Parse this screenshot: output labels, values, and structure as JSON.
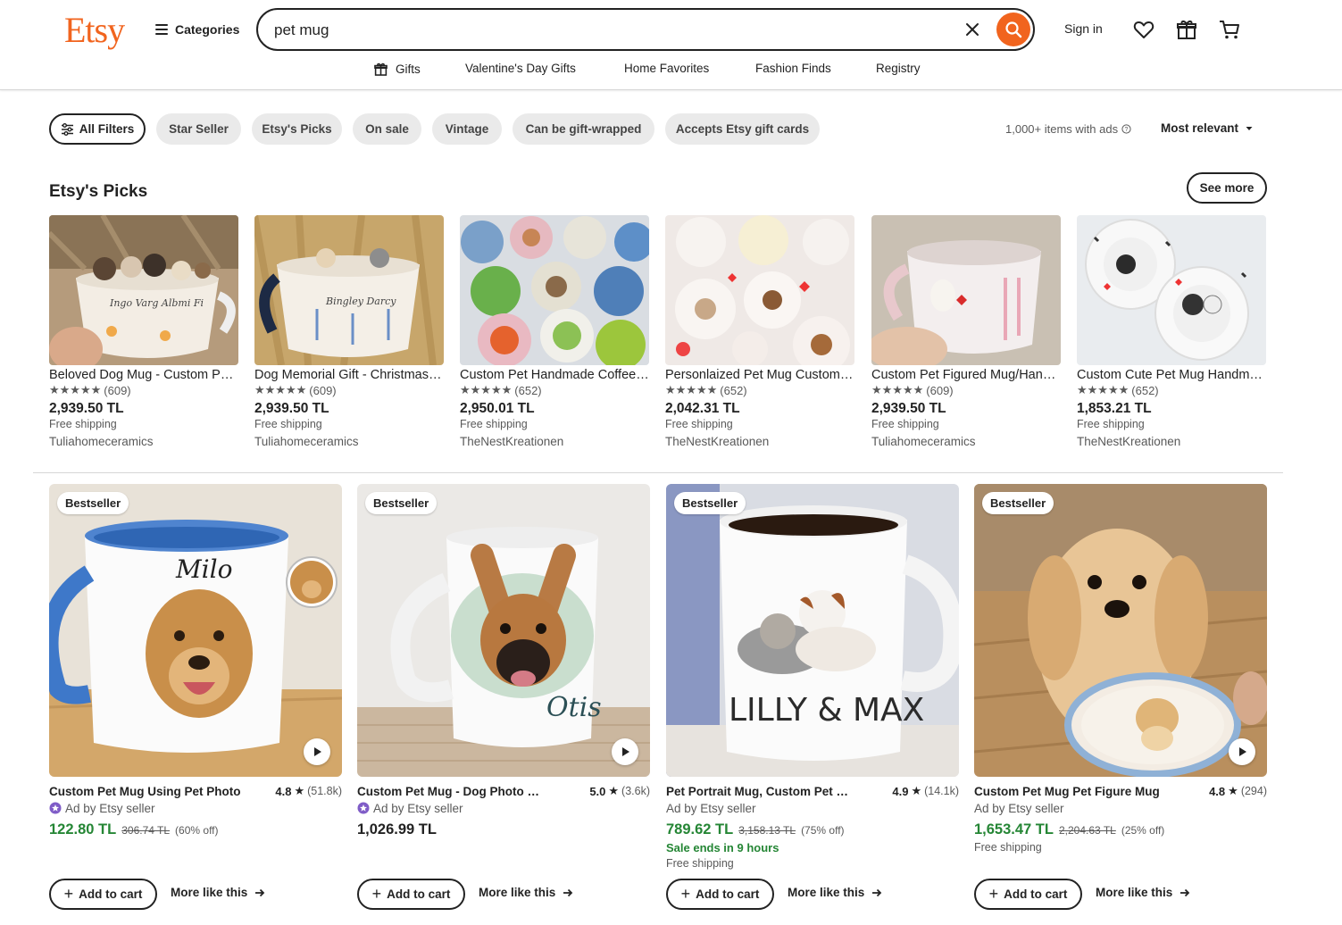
{
  "header": {
    "logo": "Etsy",
    "categories_label": "Categories",
    "search_value": "pet mug",
    "signin_label": "Sign in"
  },
  "subnav": [
    "Gifts",
    "Valentine's Day Gifts",
    "Home Favorites",
    "Fashion Finds",
    "Registry"
  ],
  "filters": {
    "all": "All Filters",
    "chips": [
      "Star Seller",
      "Etsy's Picks",
      "On sale",
      "Vintage",
      "Can be gift-wrapped",
      "Accepts Etsy gift cards"
    ],
    "items_count": "1,000+ items with ads",
    "sort_label": "Most relevant"
  },
  "picks": {
    "title": "Etsy's Picks",
    "see_more": "See more",
    "items": [
      {
        "title": "Beloved Dog Mug - Custom Pet Mug",
        "reviews": "(609)",
        "price": "2,939.50 TL",
        "shipping": "Free shipping",
        "shop": "Tuliahomeceramics"
      },
      {
        "title": "Dog Memorial Gift - Christmas Gift",
        "reviews": "(609)",
        "price": "2,939.50 TL",
        "shipping": "Free shipping",
        "shop": "Tuliahomeceramics"
      },
      {
        "title": "Custom Pet Handmade Coffee Mug",
        "reviews": "(652)",
        "price": "2,950.01 TL",
        "shipping": "Free shipping",
        "shop": "TheNestKreationen"
      },
      {
        "title": "Personlaized Pet Mug Custom Dog",
        "reviews": "(652)",
        "price": "2,042.31 TL",
        "shipping": "Free shipping",
        "shop": "TheNestKreationen"
      },
      {
        "title": "Custom Pet Figured Mug/Handmade",
        "reviews": "(609)",
        "price": "2,939.50 TL",
        "shipping": "Free shipping",
        "shop": "Tuliahomeceramics"
      },
      {
        "title": "Custom Cute Pet Mug Handmade",
        "reviews": "(652)",
        "price": "1,853.21 TL",
        "shipping": "Free shipping",
        "shop": "TheNestKreationen"
      }
    ]
  },
  "listings": [
    {
      "badge": "Bestseller",
      "title": "Custom Pet Mug Using Pet Photo",
      "rating": "4.8",
      "reviews": "(51.8k)",
      "ad": "Ad by Etsy seller",
      "star_seller": true,
      "price": "122.80 TL",
      "old_price": "306.74 TL",
      "discount": "(60% off)",
      "sale_note": "",
      "shipping": "",
      "price_color": "#258635",
      "cart": "Add to cart",
      "more": "More like this"
    },
    {
      "badge": "Bestseller",
      "title": "Custom Pet Mug - Dog Photo Mug",
      "rating": "5.0",
      "reviews": "(3.6k)",
      "ad": "Ad by Etsy seller",
      "star_seller": true,
      "price": "1,026.99 TL",
      "old_price": "",
      "discount": "",
      "sale_note": "",
      "shipping": "",
      "price_color": "#222222",
      "cart": "Add to cart",
      "more": "More like this"
    },
    {
      "badge": "Bestseller",
      "title": "Pet Portrait Mug, Custom Pet Mug",
      "rating": "4.9",
      "reviews": "(14.1k)",
      "ad": "Ad by Etsy seller",
      "star_seller": false,
      "price": "789.62 TL",
      "old_price": "3,158.13 TL",
      "discount": "(75% off)",
      "sale_note": "Sale ends in 9 hours",
      "shipping": "Free shipping",
      "price_color": "#258635",
      "cart": "Add to cart",
      "more": "More like this"
    },
    {
      "badge": "Bestseller",
      "title": "Custom Pet Mug Pet Figure Mug",
      "rating": "4.8",
      "reviews": "(294)",
      "ad": "Ad by Etsy seller",
      "star_seller": false,
      "price": "1,653.47 TL",
      "old_price": "2,204.63 TL",
      "discount": "(25% off)",
      "sale_note": "",
      "shipping": "Free shipping",
      "price_color": "#258635",
      "cart": "Add to cart",
      "more": "More like this"
    }
  ],
  "listing_texts": {
    "mug1_name": "Milo",
    "mug2_name": "Otis",
    "mug3_name": "LILLY & MAX"
  },
  "colors": {
    "brand": "#f1641e",
    "sale_green": "#258635"
  }
}
